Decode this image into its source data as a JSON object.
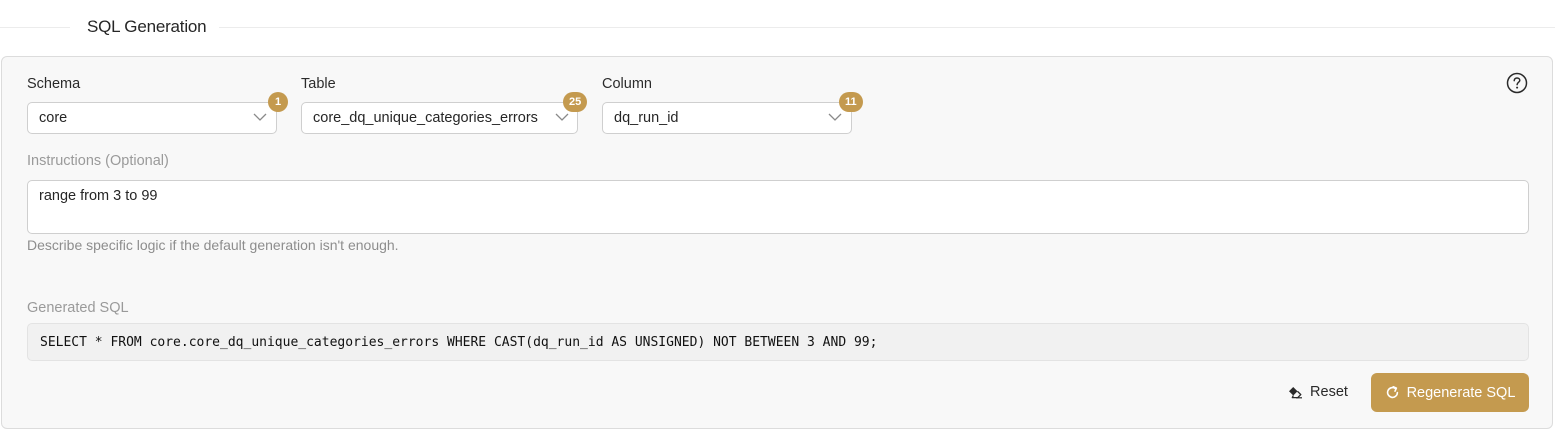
{
  "section": {
    "title": "SQL Generation"
  },
  "schema": {
    "label": "Schema",
    "value": "core",
    "count": "1"
  },
  "table": {
    "label": "Table",
    "value": "core_dq_unique_categories_errors",
    "count": "25"
  },
  "column": {
    "label": "Column",
    "value": "dq_run_id",
    "count": "11"
  },
  "instructions": {
    "label": "Instructions (Optional)",
    "value": "range from 3 to 99",
    "helper": "Describe specific logic if the default generation isn't enough."
  },
  "generated_sql": {
    "label": "Generated SQL",
    "value": "SELECT * FROM core.core_dq_unique_categories_errors WHERE CAST(dq_run_id AS UNSIGNED) NOT BETWEEN 3 AND 99;"
  },
  "actions": {
    "reset_label": "Reset",
    "regenerate_label": "Regenerate SQL"
  },
  "icons": {
    "help": "question-circle-icon",
    "chevron": "chevron-down-icon",
    "eraser": "eraser-icon",
    "refresh": "refresh-icon"
  },
  "colors": {
    "accent": "#c49a4f",
    "panel_bg": "#f8f8f8",
    "border": "#cfcfcf",
    "muted_text": "#9a9a9a"
  }
}
